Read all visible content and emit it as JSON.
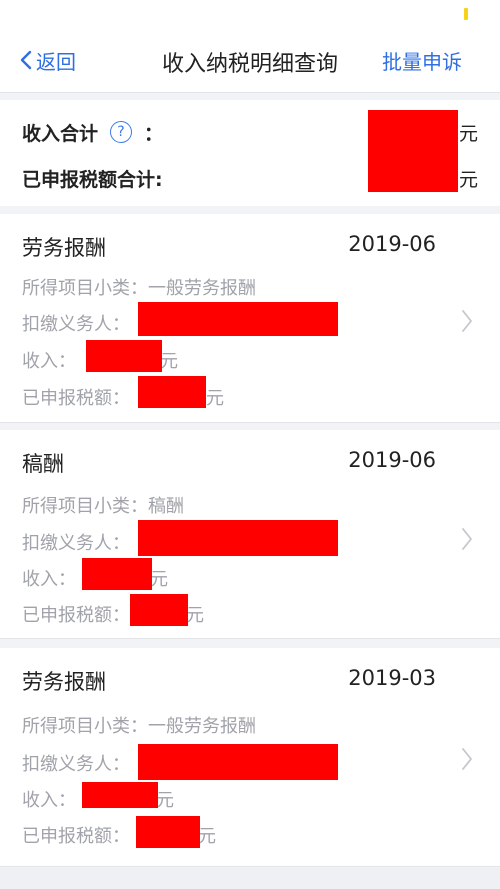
{
  "nav": {
    "back_label": "返回",
    "title": "收入纳税明细查询",
    "action_label": "批量申诉"
  },
  "summary": {
    "income_label": "收入合计",
    "colon": "：",
    "income_unit": "元",
    "tax_label": "已申报税额合计:",
    "tax_unit": "元"
  },
  "records": [
    {
      "title": "劳务报酬",
      "date": "2019-06",
      "subcategory_label": "所得项目小类：",
      "subcategory_value": "一般劳务报酬",
      "withholder_label": "扣缴义务人：",
      "income_label": "收入：",
      "income_unit": "元",
      "tax_label": "已申报税额：",
      "tax_unit": "元"
    },
    {
      "title": "稿酬",
      "date": "2019-06",
      "subcategory_label": "所得项目小类：",
      "subcategory_value": "稿酬",
      "withholder_label": "扣缴义务人：",
      "income_label": "收入：",
      "income_unit": "元",
      "tax_label": "已申报税额：",
      "tax_unit": "元"
    },
    {
      "title": "劳务报酬",
      "date": "2019-03",
      "subcategory_label": "所得项目小类：",
      "subcategory_value": "一般劳务报酬",
      "withholder_label": "扣缴义务人：",
      "income_label": "收入：",
      "income_unit": "元",
      "tax_label": "已申报税额：",
      "tax_unit": "元"
    }
  ],
  "colors": {
    "accent": "#2f6fe3",
    "redaction": "#ff0000"
  }
}
